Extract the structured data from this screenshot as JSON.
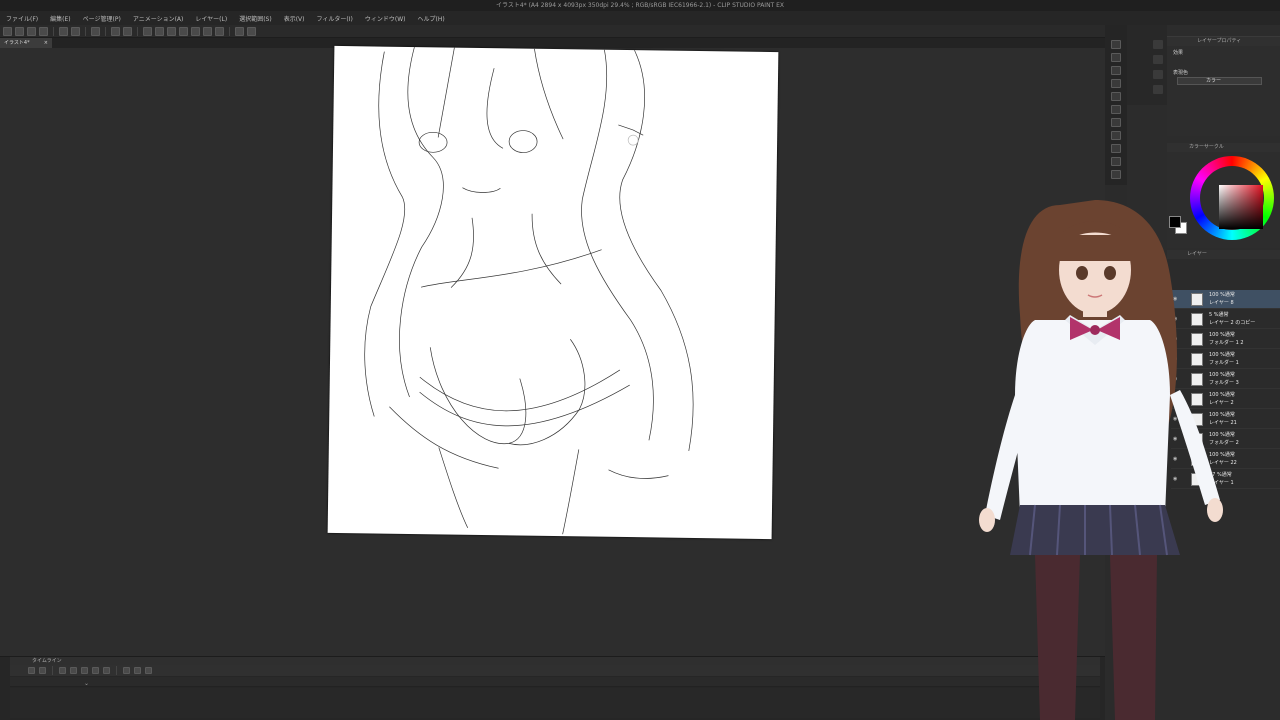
{
  "app": {
    "title": "イラスト4* (A4 2894 x 4093px 350dpi 29.4% ; RGB/sRGB IEC61966-2.1) - CLIP STUDIO PAINT EX"
  },
  "menu": [
    {
      "label": "ファイル(F)"
    },
    {
      "label": "編集(E)"
    },
    {
      "label": "ページ管理(P)"
    },
    {
      "label": "アニメーション(A)"
    },
    {
      "label": "レイヤー(L)"
    },
    {
      "label": "選択範囲(S)"
    },
    {
      "label": "表示(V)"
    },
    {
      "label": "フィルター(I)"
    },
    {
      "label": "ウィンドウ(W)"
    },
    {
      "label": "ヘルプ(H)"
    }
  ],
  "document_tab": {
    "label": "イラスト4*",
    "close": "×"
  },
  "timeline": {
    "header": "タイムライン",
    "chevron": "⌄"
  },
  "property_panel": {
    "header": "レイヤープロパティ",
    "effect_label": "効果",
    "display_color_label": "表現色",
    "display_color_value": "カラー"
  },
  "color_panel": {
    "header": "カラーサークル",
    "main_color": "#000000",
    "sub_color": "#ffffff",
    "hue_color": "#e01020"
  },
  "layer_panel": {
    "header": "レイヤー",
    "layers": [
      {
        "opacity_mode": "100 %通常",
        "name": "レイヤー 8",
        "active": true
      },
      {
        "opacity_mode": "5 %通常",
        "name": "レイヤー 2 のコピー",
        "active": false
      },
      {
        "opacity_mode": "100 %通常",
        "name": "フォルダー 1 2",
        "active": false
      },
      {
        "opacity_mode": "100 %通常",
        "name": "フォルダー 1",
        "active": false
      },
      {
        "opacity_mode": "100 %通常",
        "name": "フォルダー 3",
        "active": false
      },
      {
        "opacity_mode": "100 %通常",
        "name": "レイヤー 2",
        "active": false
      },
      {
        "opacity_mode": "100 %通常",
        "name": "レイヤー 21",
        "active": false
      },
      {
        "opacity_mode": "100 %通常",
        "name": "フォルダー 2",
        "active": false
      },
      {
        "opacity_mode": "100 %通常",
        "name": "レイヤー 22",
        "active": false
      },
      {
        "opacity_mode": "17 %通常",
        "name": "レイヤー 1",
        "active": false
      }
    ]
  },
  "colors": {
    "accent_active_layer": "#3f5063",
    "background": "#2b2b2b"
  }
}
